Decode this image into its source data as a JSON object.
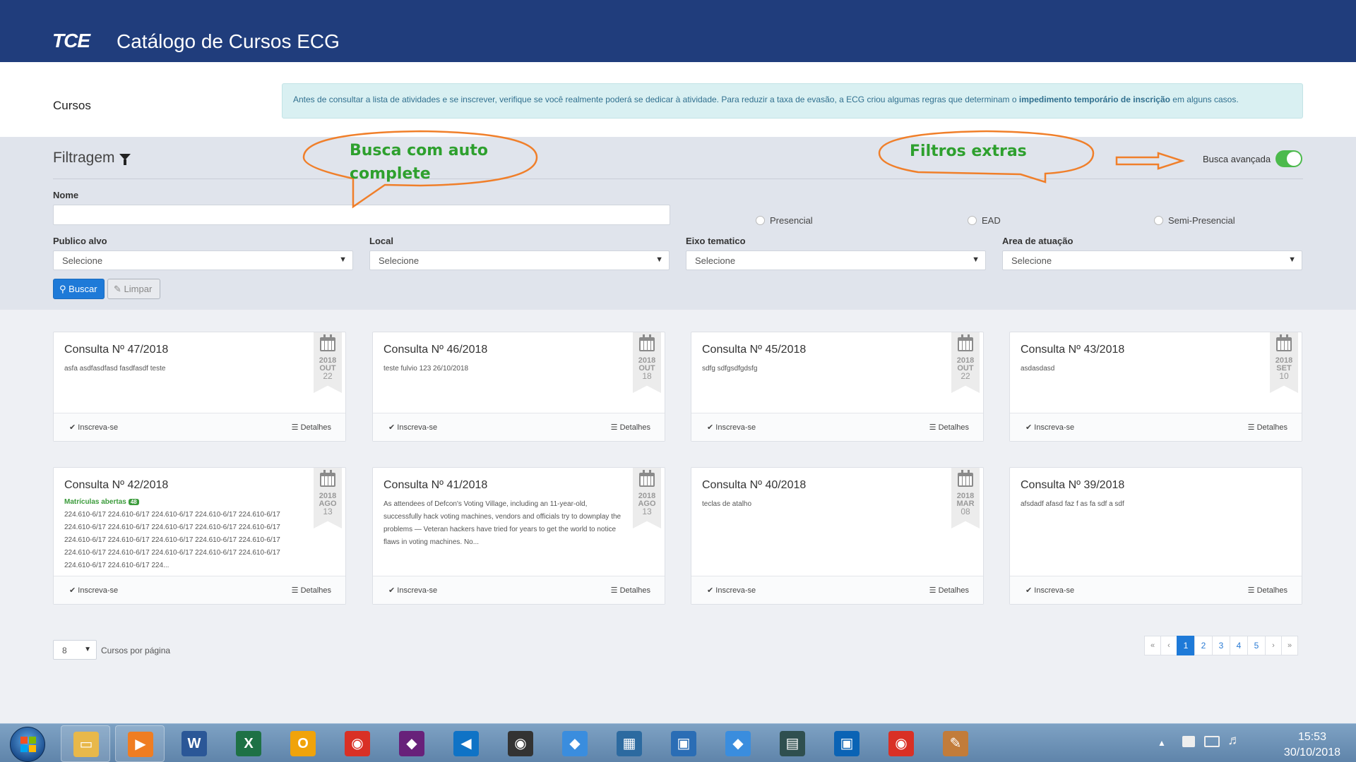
{
  "header": {
    "logo": "TCE",
    "title": "Catálogo de Cursos ECG"
  },
  "page": {
    "title": "Cursos"
  },
  "notice": {
    "text_before": "Antes de consultar a lista de atividades e se inscrever, verifique se você realmente poderá se dedicar à atividade. Para reduzir a taxa de evasão, a ECG criou algumas regras que determinam o ",
    "bold": "impedimento temporário de inscrição",
    "text_after": " em alguns casos."
  },
  "filters": {
    "title": "Filtragem",
    "advanced_label": "Busca avançada",
    "advanced_on": true,
    "name_label": "Nome",
    "name_value": "",
    "modalities": [
      "Presencial",
      "EAD",
      "Semi-Presencial"
    ],
    "selects": [
      {
        "label": "Publico alvo",
        "value": "Selecione"
      },
      {
        "label": "Local",
        "value": "Selecione"
      },
      {
        "label": "Eixo tematico",
        "value": "Selecione"
      },
      {
        "label": "Area de atuação",
        "value": "Selecione"
      }
    ],
    "search_button": "Buscar",
    "clear_button": "Limpar"
  },
  "annotations": {
    "autocomplete": "Busca com auto complete",
    "extras": "Filtros extras",
    "color": "#f07f2a",
    "text_color": "#2ea02e"
  },
  "cards": [
    {
      "title": "Consulta Nº 47/2018",
      "desc": "asfa asdfasdfasd fasdfasdf teste",
      "year": "2018",
      "month": "OUT",
      "day": "22",
      "badge": ""
    },
    {
      "title": "Consulta Nº 46/2018",
      "desc": "teste fulvio 123 26/10/2018",
      "year": "2018",
      "month": "OUT",
      "day": "18",
      "badge": ""
    },
    {
      "title": "Consulta Nº 45/2018",
      "desc": "sdfg sdfgsdfgdsfg",
      "year": "2018",
      "month": "OUT",
      "day": "22",
      "badge": ""
    },
    {
      "title": "Consulta Nº 43/2018",
      "desc": "asdasdasd",
      "year": "2018",
      "month": "SET",
      "day": "10",
      "badge": ""
    },
    {
      "title": "Consulta Nº 42/2018",
      "desc": "224.610-6/17 224.610-6/17 224.610-6/17 224.610-6/17 224.610-6/17 224.610-6/17 224.610-6/17 224.610-6/17 224.610-6/17 224.610-6/17 224.610-6/17 224.610-6/17 224.610-6/17 224.610-6/17 224.610-6/17 224.610-6/17 224.610-6/17 224.610-6/17 224.610-6/17 224.610-6/17 224.610-6/17 224.610-6/17 224...",
      "year": "2018",
      "month": "AGO",
      "day": "13",
      "badge": "Matrículas abertas",
      "badge_count": "48"
    },
    {
      "title": "Consulta Nº 41/2018",
      "desc": "As attendees of Defcon's Voting Village, including an 11-year-old, successfully hack voting machines, vendors and officials try to downplay the problems — Veteran hackers have tried for years to get the world to notice flaws in voting machines. No...",
      "year": "2018",
      "month": "AGO",
      "day": "13",
      "badge": ""
    },
    {
      "title": "Consulta Nº 40/2018",
      "desc": "teclas de atalho",
      "year": "2018",
      "month": "MAR",
      "day": "08",
      "badge": ""
    },
    {
      "title": "Consulta Nº 39/2018",
      "desc": "afsdadf afasd faz f as fa sdf a sdf",
      "year": "",
      "month": "",
      "day": "",
      "badge": ""
    }
  ],
  "card_actions": {
    "enroll": "Inscreva-se",
    "details": "Detalhes"
  },
  "pagination": {
    "per_page_value": "8",
    "per_page_label": "Cursos por página",
    "pages": [
      "«",
      "‹",
      "1",
      "2",
      "3",
      "4",
      "5",
      "›",
      "»"
    ],
    "active": "1"
  },
  "taskbar": {
    "time": "15:53",
    "date": "30/10/2018",
    "apps": [
      "file-explorer",
      "media-player",
      "word",
      "excel",
      "outlook",
      "chrome",
      "visual-studio",
      "vscode",
      "github-desktop",
      "sourcetree",
      "network-tool",
      "remote-desktop",
      "sourcetree-2",
      "terminal",
      "intel-tool",
      "chrome-2",
      "paint"
    ]
  }
}
